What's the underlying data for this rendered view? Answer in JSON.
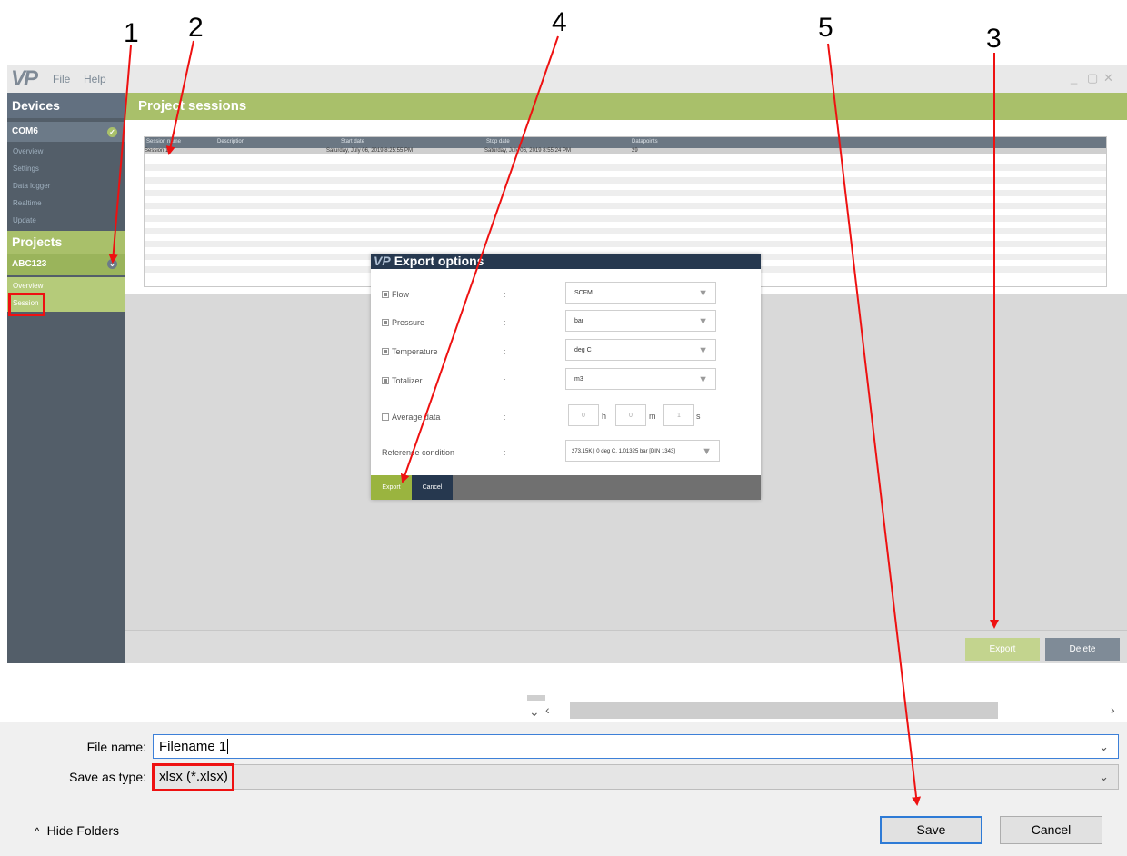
{
  "callouts": [
    "1",
    "2",
    "4",
    "5",
    "3"
  ],
  "app": {
    "logo": "VP",
    "menu": [
      "File",
      "Help"
    ],
    "window_controls": [
      "_",
      "▢",
      "✕"
    ]
  },
  "sidebar": {
    "devices_header": "Devices",
    "device_name": "COM6",
    "device_items": [
      "Overview",
      "Settings",
      "Data logger",
      "Realtime",
      "Update"
    ],
    "projects_header": "Projects",
    "project_name": "ABC123",
    "project_items": [
      "Overview",
      "Session"
    ]
  },
  "content": {
    "header": "Project sessions",
    "columns": [
      "Session name",
      "Description",
      "Start date",
      "Stop date",
      "Datapoints"
    ],
    "rows": [
      {
        "name": "Session 1",
        "description": "",
        "start": "Saturday, July 06, 2019 8:25:55 PM",
        "stop": "Saturday, July 06, 2019 8:55:24 PM",
        "datapoints": "29"
      }
    ],
    "export_button": "Export",
    "delete_button": "Delete"
  },
  "modal": {
    "logo": "VP",
    "title": "Export options",
    "options": [
      {
        "label": "Flow",
        "checked": true,
        "value": "SCFM"
      },
      {
        "label": "Pressure",
        "checked": true,
        "value": "bar"
      },
      {
        "label": "Temperature",
        "checked": true,
        "value": "deg C"
      },
      {
        "label": "Totalizer",
        "checked": true,
        "value": "m3"
      }
    ],
    "colon": ":",
    "average_label": "Average data",
    "average_values": [
      "0",
      "0",
      "1"
    ],
    "average_units": [
      "h",
      "m",
      "s"
    ],
    "reference_label": "Reference condition",
    "reference_value": "273.15K | 0 deg C, 1.01325 bar [DIN 1343]",
    "export_button": "Export",
    "cancel_button": "Cancel"
  },
  "save_dialog": {
    "file_name_label": "File name:",
    "file_name_value": "Filename 1",
    "save_type_label": "Save as type:",
    "save_type_value": "xlsx (*.xlsx)",
    "hide_folders": "Hide Folders",
    "save_button": "Save",
    "cancel_button": "Cancel"
  },
  "colors": {
    "annotation_red": "#ee1111",
    "accent_green": "#a9c06a",
    "sidebar_slate": "#535e69",
    "modal_navy": "#26384f"
  }
}
